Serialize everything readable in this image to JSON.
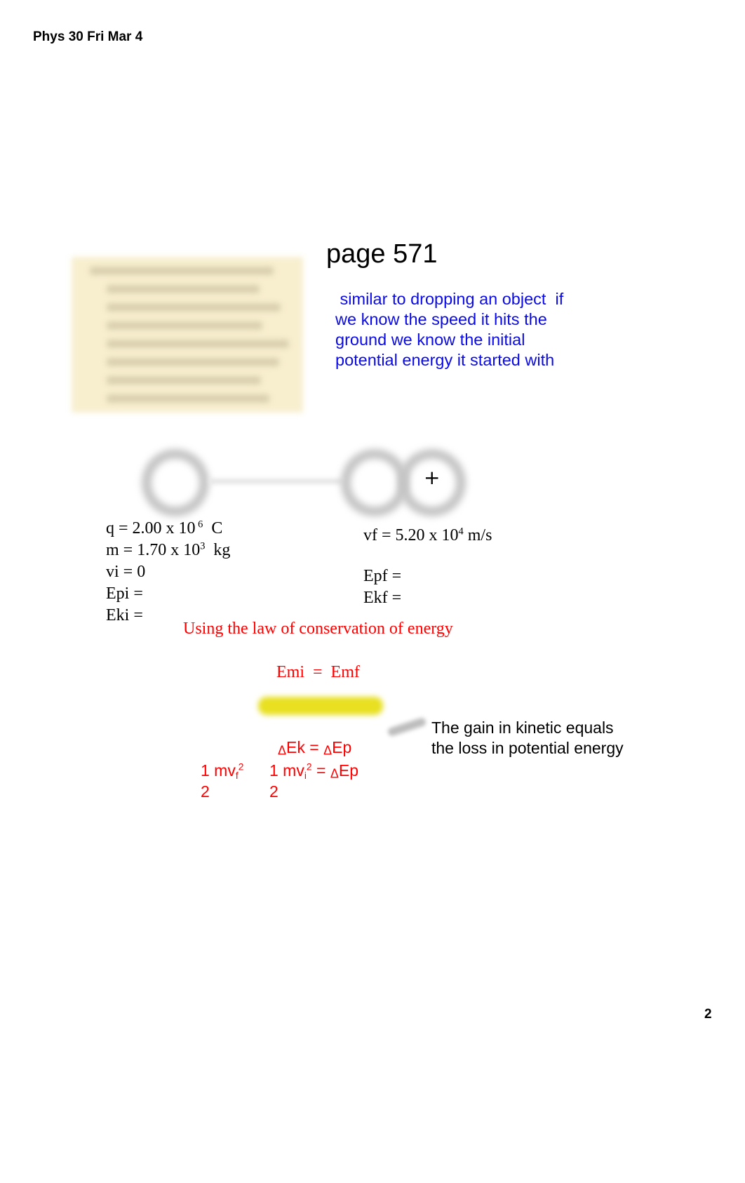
{
  "header": {
    "title": "Phys 30 Fri Mar 4"
  },
  "page_number": "2",
  "page_title": "page 571",
  "note_blue": [
    " similar to dropping an object  if",
    "we know the speed it hits the",
    "ground we know the initial",
    "potential energy it started with"
  ],
  "diagram": {
    "charge_symbol": "+"
  },
  "givens_left": {
    "q": {
      "prefix": "q = 2.00 x 10",
      "exp": " 6",
      "unit": "  C"
    },
    "m": {
      "prefix": "m = 1.70 x 10",
      "exp": "3",
      "unit": "  kg"
    },
    "vi": "vi = 0",
    "epi": "Epi =",
    "eki": "Eki ="
  },
  "givens_right": {
    "vf": {
      "prefix": "vf = 5.20 x 10",
      "exp": "4",
      "unit": " m/s"
    },
    "epf": "Epf =",
    "ekf": "Ekf ="
  },
  "conservation_note": "Using the law of conservation of energy",
  "equations": {
    "emi_emf": "Emi  =  Emf",
    "delta_symbol": "Δ",
    "dek_lhs": "Ek = ",
    "dep_rhs": "Ep",
    "kin_one": "1 mv",
    "sub_f": "f",
    "sub_i": "i",
    "sq": "2",
    "eq_dep": " = ",
    "ep": "Ep",
    "denom": "2"
  },
  "annotation": [
    "The gain in kinetic equals",
    "the loss in potential energy"
  ]
}
